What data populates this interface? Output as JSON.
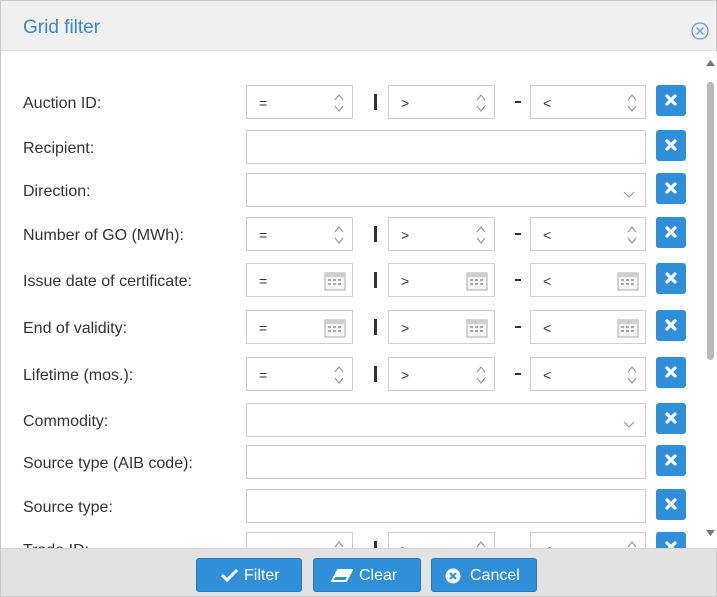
{
  "dialog": {
    "title": "Grid filter"
  },
  "rows": [
    {
      "label": "Auction ID:",
      "type": "range-number",
      "ops": [
        "=",
        ">",
        "<"
      ]
    },
    {
      "label": "Recipient:",
      "type": "text"
    },
    {
      "label": "Direction:",
      "type": "select"
    },
    {
      "label": "Number of GO (MWh):",
      "type": "range-number",
      "ops": [
        "=",
        ">",
        "<"
      ]
    },
    {
      "label": "Issue date of certificate:",
      "type": "range-date",
      "ops": [
        "=",
        ">",
        "<"
      ]
    },
    {
      "label": "End of validity:",
      "type": "range-date",
      "ops": [
        "=",
        ">",
        "<"
      ]
    },
    {
      "label": "Lifetime (mos.):",
      "type": "range-number",
      "ops": [
        "=",
        ">",
        "<"
      ]
    },
    {
      "label": "Commodity:",
      "type": "select"
    },
    {
      "label": "Source type (AIB code):",
      "type": "text"
    },
    {
      "label": "Source type:",
      "type": "text"
    },
    {
      "label": "Trade ID:",
      "type": "range-number",
      "ops": [
        "=",
        ">",
        "<"
      ]
    }
  ],
  "separators": {
    "bar": "|",
    "dash": "-"
  },
  "footer": {
    "filter_label": "Filter",
    "clear_label": "Clear",
    "cancel_label": "Cancel"
  },
  "colors": {
    "accent": "#2f8fd8",
    "title": "#3a86c8",
    "footer_bg": "#e2e2e2"
  },
  "icons": {
    "close": "close-circle-icon",
    "clear_row": "x-icon",
    "spinner": "spinner-arrows-icon",
    "calendar": "calendar-icon",
    "dropdown": "chevron-down-icon",
    "filter": "checkmark-icon",
    "clear": "eraser-icon",
    "cancel": "cancel-circle-icon"
  }
}
